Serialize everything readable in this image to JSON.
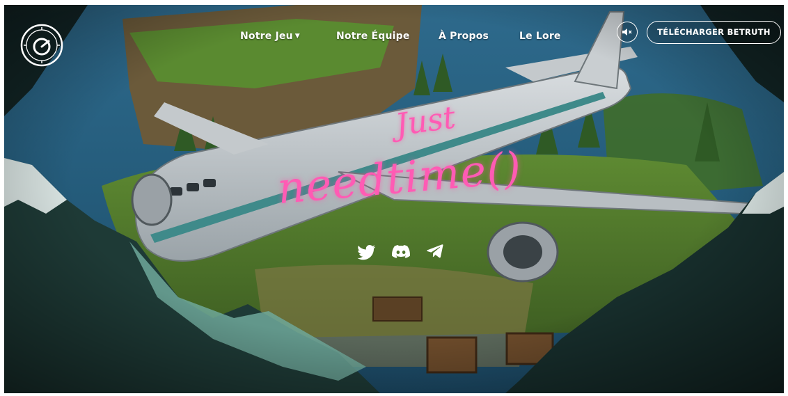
{
  "nav": {
    "items": [
      {
        "label": "Notre Jeu",
        "has_dropdown": true
      },
      {
        "label": "Notre Équipe",
        "has_dropdown": false
      },
      {
        "label": "À Propos",
        "has_dropdown": false
      },
      {
        "label": "Le Lore",
        "has_dropdown": false
      }
    ],
    "download_label": "TÉLÉCHARGER BETRUTH",
    "sound_icon": "speaker-muted-icon"
  },
  "hero": {
    "title_line1": "Just",
    "title_line2": "needtime()"
  },
  "socials": [
    {
      "icon": "twitter-icon"
    },
    {
      "icon": "discord-icon"
    },
    {
      "icon": "telegram-icon"
    }
  ],
  "colors": {
    "accent": "#ff5bb4",
    "text": "#ffffff",
    "sea": "#2a5a78",
    "jungle": "#4f7a2c",
    "mountain": "#1f3b3a"
  }
}
